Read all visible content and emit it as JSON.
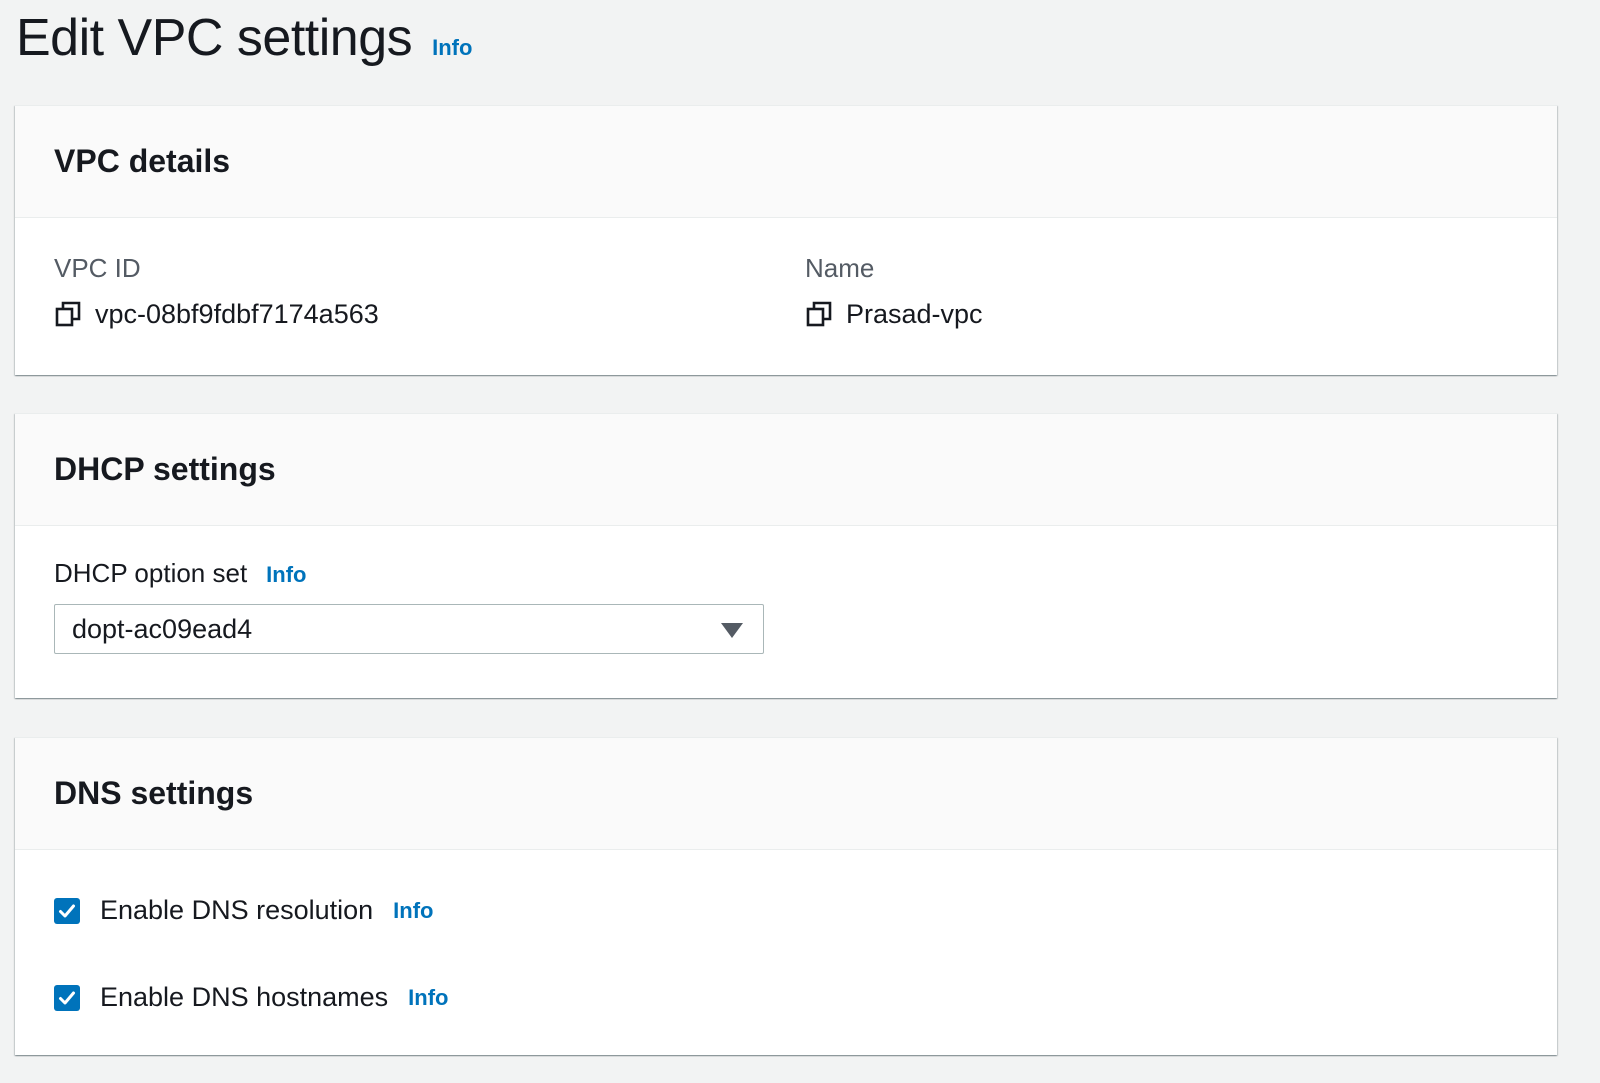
{
  "page": {
    "title": "Edit VPC settings",
    "info_label": "Info"
  },
  "vpc_details": {
    "title": "VPC details",
    "vpc_id_label": "VPC ID",
    "vpc_id_value": "vpc-08bf9fdbf7174a563",
    "name_label": "Name",
    "name_value": "Prasad-vpc"
  },
  "dhcp_settings": {
    "title": "DHCP settings",
    "option_set_label": "DHCP option set",
    "info_label": "Info",
    "option_set_value": "dopt-ac09ead4"
  },
  "dns_settings": {
    "title": "DNS settings",
    "options": [
      {
        "label": "Enable DNS resolution",
        "checked": true,
        "info_label": "Info"
      },
      {
        "label": "Enable DNS hostnames",
        "checked": true,
        "info_label": "Info"
      }
    ]
  },
  "icons": {
    "copy": "copy-icon",
    "checkbox": "checkmark-icon",
    "dropdown": "caret-down-icon"
  },
  "colors": {
    "link": "#0073bb",
    "checkbox": "#0073bb",
    "background": "#f2f3f3"
  }
}
